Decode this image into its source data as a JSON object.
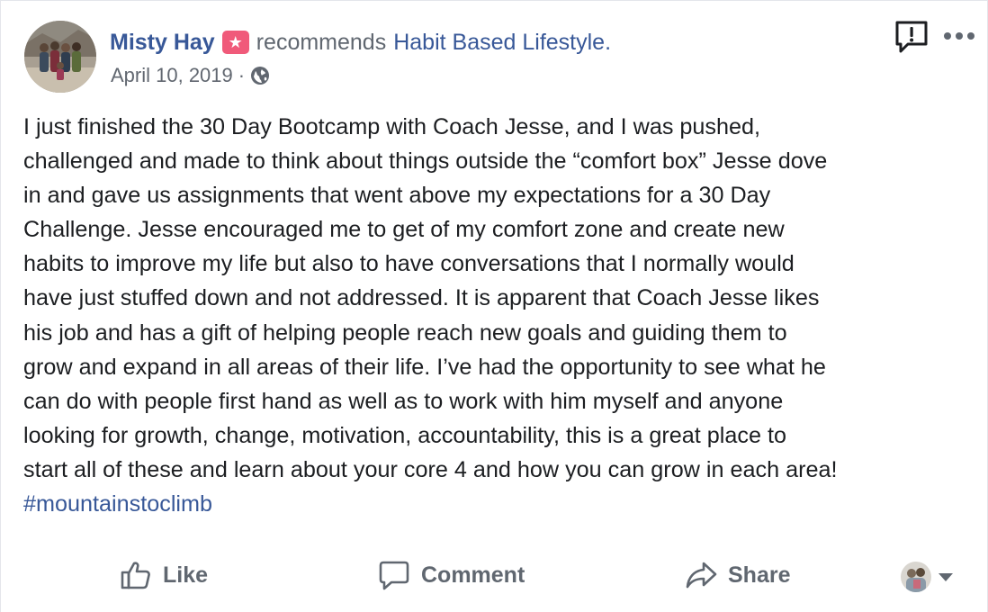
{
  "post": {
    "author": "Misty Hay",
    "recommend_icon": "star-badge-icon",
    "verb": "recommends",
    "page_name": "Habit Based Lifestyle.",
    "date": "April 10, 2019",
    "separator": "·",
    "privacy_icon": "globe-icon",
    "body_lines": [
      "I just finished the 30 Day Bootcamp with Coach Jesse, and I was pushed,",
      "challenged and made to think about things outside the “comfort box” Jesse dove",
      "in and gave us assignments that went above my expectations for a 30 Day",
      "Challenge. Jesse encouraged me to get of my comfort zone and create new",
      "habits to improve my life but also to have conversations that I normally would",
      "have just stuffed down and not addressed. It is apparent that Coach Jesse likes",
      "his job and has a gift of helping people reach new goals and guiding them to",
      "grow and expand in all areas of their life. I’ve had the opportunity to see what he",
      "can do with people first hand as well as to work with him myself and anyone",
      "looking for growth, change, motivation, accountability, this is a great place to",
      "start all of these and learn about your core 4 and how you can grow in each area!"
    ],
    "hashtag": "#mountainstoclimb"
  },
  "header_actions": {
    "report_icon": "report-icon",
    "more_icon": "more-options-icon"
  },
  "actions": {
    "like": "Like",
    "comment": "Comment",
    "share": "Share"
  },
  "colors": {
    "link": "#385898",
    "text": "#1c1e21",
    "secondary": "#606770",
    "badge": "#f05a7a"
  }
}
